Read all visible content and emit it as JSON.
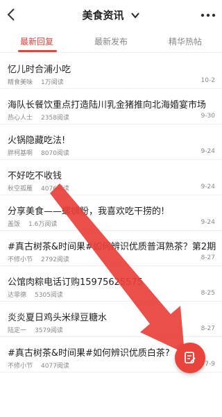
{
  "header": {
    "title": "美食资讯"
  },
  "tabs": [
    {
      "label": "最新回复"
    },
    {
      "label": "最新发布"
    },
    {
      "label": "精华热帖"
    }
  ],
  "posts": [
    {
      "title": "忆儿时合浦小吃",
      "author": "精食美味",
      "reads": "1万阅读",
      "date": "10-2"
    },
    {
      "title": "海队长餐饮重点打造陆川乳金猪推向北海婚宴市场",
      "author": "热心人士",
      "reads": "2358阅读",
      "date": "9-30"
    },
    {
      "title": "火锅隐藏吃法!",
      "author": "胖柯基啊",
      "reads": "8070阅读",
      "date": "9-24"
    },
    {
      "title": "不好吃不收钱",
      "author": "秋空孤雁",
      "reads": "4076阅读",
      "date": "9-24"
    },
    {
      "title": "分享美食——螺蛳粉，我喜欢吃干捞的!",
      "author": "盖饭",
      "reads": "1.6万阅读",
      "date": "9-24"
    },
    {
      "title": "#真古树茶&时间果#如何辨识优质普洱熟茶？第2期",
      "author": "不修小节",
      "reads": "2792阅读",
      "date": "8-27"
    },
    {
      "title": "公馆肉粽电话订购15975625575",
      "author": "达菲德",
      "reads": "5305阅读",
      "date": "8-25"
    },
    {
      "title": "炎炎夏日鸡头米绿豆糖水",
      "author": "陆定一",
      "reads": "3579阅读",
      "date": "8-27"
    },
    {
      "title": "#真古树茶&时间果#如何辨识优质白茶?",
      "author": "不修小节",
      "reads": "4077阅读",
      "date": "7-9"
    }
  ],
  "icons": {
    "back": "back-arrow-icon",
    "more": "more-dots-icon",
    "fab": "edit-post-icon"
  },
  "colors": {
    "accent": "#e2453c"
  }
}
